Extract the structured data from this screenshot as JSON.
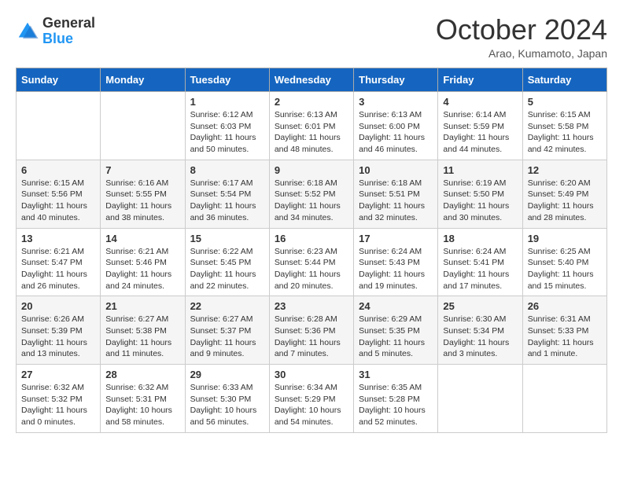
{
  "header": {
    "logo_general": "General",
    "logo_blue": "Blue",
    "month_title": "October 2024",
    "location": "Arao, Kumamoto, Japan"
  },
  "days_of_week": [
    "Sunday",
    "Monday",
    "Tuesday",
    "Wednesday",
    "Thursday",
    "Friday",
    "Saturday"
  ],
  "weeks": [
    [
      {
        "day": "",
        "info": ""
      },
      {
        "day": "",
        "info": ""
      },
      {
        "day": "1",
        "info": "Sunrise: 6:12 AM\nSunset: 6:03 PM\nDaylight: 11 hours and 50 minutes."
      },
      {
        "day": "2",
        "info": "Sunrise: 6:13 AM\nSunset: 6:01 PM\nDaylight: 11 hours and 48 minutes."
      },
      {
        "day": "3",
        "info": "Sunrise: 6:13 AM\nSunset: 6:00 PM\nDaylight: 11 hours and 46 minutes."
      },
      {
        "day": "4",
        "info": "Sunrise: 6:14 AM\nSunset: 5:59 PM\nDaylight: 11 hours and 44 minutes."
      },
      {
        "day": "5",
        "info": "Sunrise: 6:15 AM\nSunset: 5:58 PM\nDaylight: 11 hours and 42 minutes."
      }
    ],
    [
      {
        "day": "6",
        "info": "Sunrise: 6:15 AM\nSunset: 5:56 PM\nDaylight: 11 hours and 40 minutes."
      },
      {
        "day": "7",
        "info": "Sunrise: 6:16 AM\nSunset: 5:55 PM\nDaylight: 11 hours and 38 minutes."
      },
      {
        "day": "8",
        "info": "Sunrise: 6:17 AM\nSunset: 5:54 PM\nDaylight: 11 hours and 36 minutes."
      },
      {
        "day": "9",
        "info": "Sunrise: 6:18 AM\nSunset: 5:52 PM\nDaylight: 11 hours and 34 minutes."
      },
      {
        "day": "10",
        "info": "Sunrise: 6:18 AM\nSunset: 5:51 PM\nDaylight: 11 hours and 32 minutes."
      },
      {
        "day": "11",
        "info": "Sunrise: 6:19 AM\nSunset: 5:50 PM\nDaylight: 11 hours and 30 minutes."
      },
      {
        "day": "12",
        "info": "Sunrise: 6:20 AM\nSunset: 5:49 PM\nDaylight: 11 hours and 28 minutes."
      }
    ],
    [
      {
        "day": "13",
        "info": "Sunrise: 6:21 AM\nSunset: 5:47 PM\nDaylight: 11 hours and 26 minutes."
      },
      {
        "day": "14",
        "info": "Sunrise: 6:21 AM\nSunset: 5:46 PM\nDaylight: 11 hours and 24 minutes."
      },
      {
        "day": "15",
        "info": "Sunrise: 6:22 AM\nSunset: 5:45 PM\nDaylight: 11 hours and 22 minutes."
      },
      {
        "day": "16",
        "info": "Sunrise: 6:23 AM\nSunset: 5:44 PM\nDaylight: 11 hours and 20 minutes."
      },
      {
        "day": "17",
        "info": "Sunrise: 6:24 AM\nSunset: 5:43 PM\nDaylight: 11 hours and 19 minutes."
      },
      {
        "day": "18",
        "info": "Sunrise: 6:24 AM\nSunset: 5:41 PM\nDaylight: 11 hours and 17 minutes."
      },
      {
        "day": "19",
        "info": "Sunrise: 6:25 AM\nSunset: 5:40 PM\nDaylight: 11 hours and 15 minutes."
      }
    ],
    [
      {
        "day": "20",
        "info": "Sunrise: 6:26 AM\nSunset: 5:39 PM\nDaylight: 11 hours and 13 minutes."
      },
      {
        "day": "21",
        "info": "Sunrise: 6:27 AM\nSunset: 5:38 PM\nDaylight: 11 hours and 11 minutes."
      },
      {
        "day": "22",
        "info": "Sunrise: 6:27 AM\nSunset: 5:37 PM\nDaylight: 11 hours and 9 minutes."
      },
      {
        "day": "23",
        "info": "Sunrise: 6:28 AM\nSunset: 5:36 PM\nDaylight: 11 hours and 7 minutes."
      },
      {
        "day": "24",
        "info": "Sunrise: 6:29 AM\nSunset: 5:35 PM\nDaylight: 11 hours and 5 minutes."
      },
      {
        "day": "25",
        "info": "Sunrise: 6:30 AM\nSunset: 5:34 PM\nDaylight: 11 hours and 3 minutes."
      },
      {
        "day": "26",
        "info": "Sunrise: 6:31 AM\nSunset: 5:33 PM\nDaylight: 11 hours and 1 minute."
      }
    ],
    [
      {
        "day": "27",
        "info": "Sunrise: 6:32 AM\nSunset: 5:32 PM\nDaylight: 11 hours and 0 minutes."
      },
      {
        "day": "28",
        "info": "Sunrise: 6:32 AM\nSunset: 5:31 PM\nDaylight: 10 hours and 58 minutes."
      },
      {
        "day": "29",
        "info": "Sunrise: 6:33 AM\nSunset: 5:30 PM\nDaylight: 10 hours and 56 minutes."
      },
      {
        "day": "30",
        "info": "Sunrise: 6:34 AM\nSunset: 5:29 PM\nDaylight: 10 hours and 54 minutes."
      },
      {
        "day": "31",
        "info": "Sunrise: 6:35 AM\nSunset: 5:28 PM\nDaylight: 10 hours and 52 minutes."
      },
      {
        "day": "",
        "info": ""
      },
      {
        "day": "",
        "info": ""
      }
    ]
  ]
}
